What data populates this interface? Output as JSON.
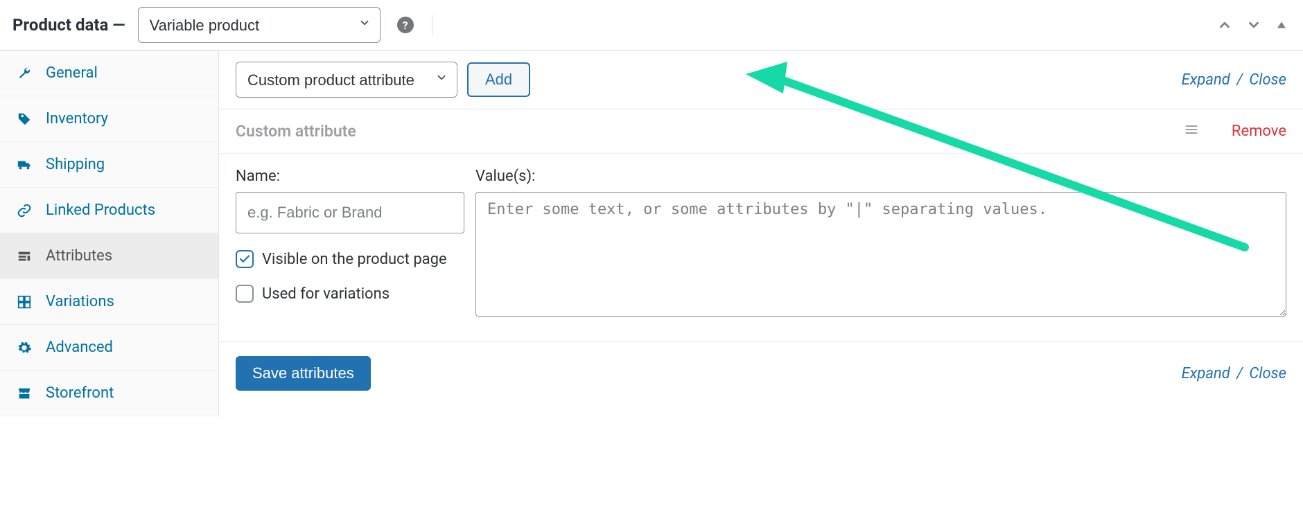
{
  "header": {
    "title": "Product data —",
    "product_type": "Variable product",
    "help_char": "?"
  },
  "tabs": [
    {
      "key": "general",
      "label": "General",
      "active": false
    },
    {
      "key": "inventory",
      "label": "Inventory",
      "active": false
    },
    {
      "key": "shipping",
      "label": "Shipping",
      "active": false
    },
    {
      "key": "linked",
      "label": "Linked Products",
      "active": false
    },
    {
      "key": "attributes",
      "label": "Attributes",
      "active": true
    },
    {
      "key": "variations",
      "label": "Variations",
      "active": false
    },
    {
      "key": "advanced",
      "label": "Advanced",
      "active": false
    },
    {
      "key": "storefront",
      "label": "Storefront",
      "active": false
    }
  ],
  "toolbar": {
    "attribute_type": "Custom product attribute",
    "add_label": "Add",
    "expand_label": "Expand",
    "close_label": "Close"
  },
  "attribute": {
    "heading": "Custom attribute",
    "remove_label": "Remove",
    "name_label": "Name:",
    "name_placeholder": "e.g. Fabric or Brand",
    "name_value": "",
    "values_label": "Value(s):",
    "values_placeholder": "Enter some text, or some attributes by \"|\" separating values.",
    "values_value": "",
    "visible_label": "Visible on the product page",
    "visible_checked": true,
    "variations_label": "Used for variations",
    "variations_checked": false
  },
  "footer": {
    "save_label": "Save attributes",
    "expand_label": "Expand",
    "close_label": "Close"
  },
  "colors": {
    "link": "#2271b1",
    "danger": "#d63638",
    "annotation": "#16d9a8"
  }
}
